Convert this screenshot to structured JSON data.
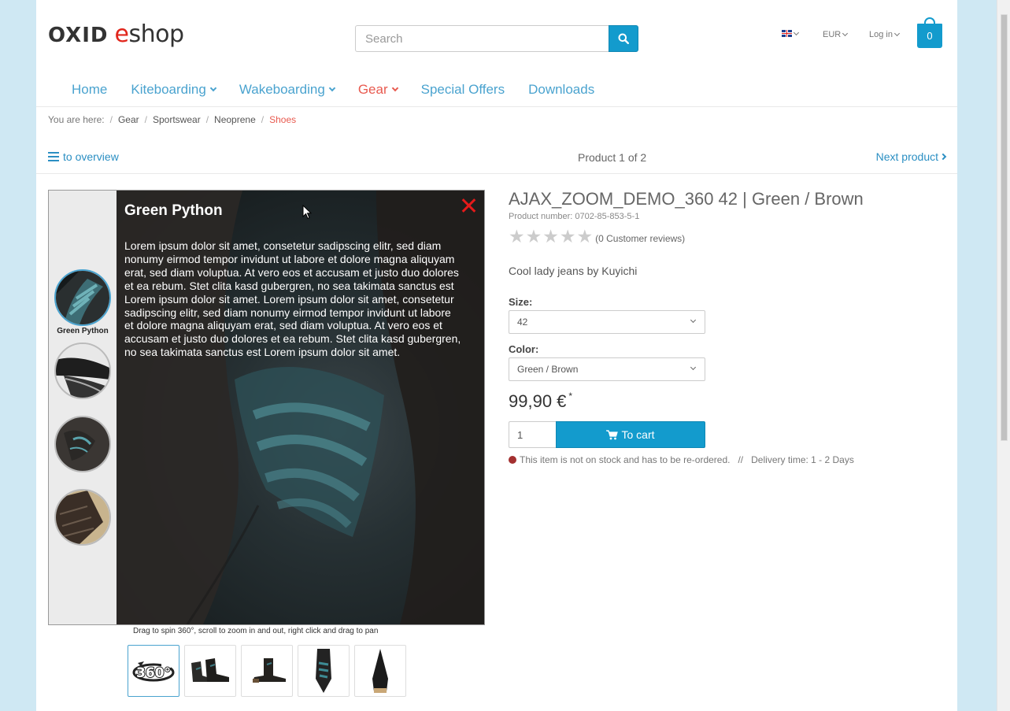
{
  "header": {
    "logo_part1": "OXID",
    "logo_part2": "e",
    "logo_part3": "shop",
    "search_placeholder": "Search",
    "language_icon": "uk-flag-icon",
    "currency": "EUR",
    "login": "Log in",
    "basket_count": "0"
  },
  "nav": {
    "items": [
      {
        "label": "Home",
        "dropdown": false,
        "active": false
      },
      {
        "label": "Kiteboarding",
        "dropdown": true,
        "active": false
      },
      {
        "label": "Wakeboarding",
        "dropdown": true,
        "active": false
      },
      {
        "label": "Gear",
        "dropdown": true,
        "active": true
      },
      {
        "label": "Special Offers",
        "dropdown": false,
        "active": false
      },
      {
        "label": "Downloads",
        "dropdown": false,
        "active": false
      }
    ]
  },
  "breadcrumb": {
    "prefix": "You are here:",
    "items": [
      "Gear",
      "Sportswear",
      "Neoprene",
      "Shoes"
    ]
  },
  "pager": {
    "overview": "to overview",
    "count": "Product 1 of 2",
    "next": "Next product"
  },
  "viewer": {
    "selected_label": "Green Python",
    "overlay_title": "Green Python",
    "overlay_text": "Lorem ipsum dolor sit amet, consetetur sadipscing elitr, sed diam nonumy eirmod tempor invidunt ut labore et dolore magna aliquyam erat, sed diam voluptua. At vero eos et accusam et justo duo dolores et ea rebum. Stet clita kasd gubergren, no sea takimata sanctus est Lorem ipsum dolor sit amet. Lorem ipsum dolor sit amet, consetetur sadipscing elitr, sed diam nonumy eirmod tempor invidunt ut labore et dolore magna aliquyam erat, sed diam voluptua. At vero eos et accusam et justo duo dolores et ea rebum. Stet clita kasd gubergren, no sea takimata sanctus est Lorem ipsum dolor sit amet.",
    "hint": "Drag to spin 360°, scroll to zoom in and out, right click and drag to pan",
    "spin_badge": "360°"
  },
  "product": {
    "title": "AJAX_ZOOM_DEMO_360 42 | Green / Brown",
    "number": "Product number: 0702-85-853-5-1",
    "reviews": "(0 Customer reviews)",
    "rating": 0,
    "short_desc": "Cool lady jeans by Kuyichi",
    "size_label": "Size:",
    "size_value": "42",
    "color_label": "Color:",
    "color_value": "Green / Brown",
    "price": "99,90 €",
    "price_note": "*",
    "qty": "1",
    "to_cart": "To cart",
    "stock_text": "This item is not on stock and has to be re-ordered.",
    "divider": "//",
    "delivery": "Delivery time: 1 - 2 Days"
  },
  "colors": {
    "accent": "#139bcd",
    "nav_link": "#4aa3cf",
    "active": "#e85a4f",
    "close": "#e51a1a",
    "stock_dot": "#a33030"
  }
}
